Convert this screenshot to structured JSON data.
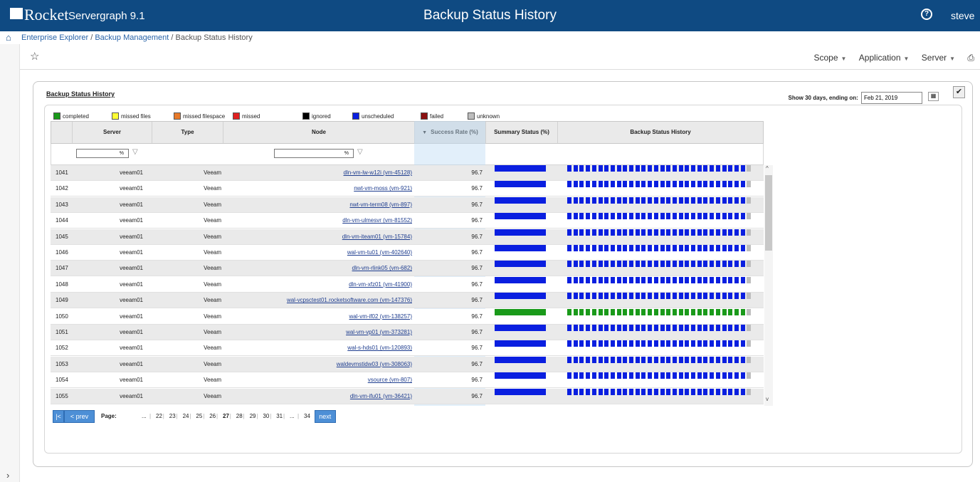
{
  "app": {
    "brand": "Rocket",
    "product": "Servergraph 9.1",
    "page_title": "Backup Status History",
    "user": "steve",
    "help_icon": "?"
  },
  "breadcrumb": {
    "items": [
      "Enterprise Explorer",
      "Backup Management",
      "Backup Status History"
    ],
    "separator": "/"
  },
  "toolbar": {
    "menus": [
      "Scope",
      "Application",
      "Server"
    ]
  },
  "panel": {
    "title": "Backup Status History",
    "show_prefix": "Show 30 days, ending on:",
    "date_value": "Feb 21, 2019"
  },
  "legend": [
    {
      "label": "completed",
      "color": "#1a9a1a"
    },
    {
      "label": "missed files",
      "color": "#ffff33"
    },
    {
      "label": "missed filespace",
      "color": "#e87a2a"
    },
    {
      "label": "missed",
      "color": "#e02020"
    },
    {
      "label": "ignored",
      "color": "#000000"
    },
    {
      "label": "unscheduled",
      "color": "#0a1fe0"
    },
    {
      "label": "failed",
      "color": "#8b1010"
    },
    {
      "label": "unknown",
      "color": "#bdbdbd"
    }
  ],
  "columns": {
    "server": "Server",
    "type": "Type",
    "node": "Node",
    "rate": "Success Rate (%)",
    "summary": "Summary Status (%)",
    "history": "Backup Status History"
  },
  "filters": {
    "server": "%",
    "node": "%"
  },
  "rows": [
    {
      "id": "1041",
      "server": "veeam01",
      "type": "Veeam",
      "node": "dln-vm-lw-w12i (vm-45128)",
      "rate": "96.7",
      "status": "unscheduled"
    },
    {
      "id": "1042",
      "server": "veeam01",
      "type": "Veeam",
      "node": "nwt-vm-moss (vm-921)",
      "rate": "96.7",
      "status": "unscheduled"
    },
    {
      "id": "1043",
      "server": "veeam01",
      "type": "Veeam",
      "node": "nwt-vm-term08 (vm-897)",
      "rate": "96.7",
      "status": "unscheduled"
    },
    {
      "id": "1044",
      "server": "veeam01",
      "type": "Veeam",
      "node": "dln-vm-ulmesvr (vm-81552)",
      "rate": "96.7",
      "status": "unscheduled"
    },
    {
      "id": "1045",
      "server": "veeam01",
      "type": "Veeam",
      "node": "dln-vm-iteam01 (vm-15784)",
      "rate": "96.7",
      "status": "unscheduled"
    },
    {
      "id": "1046",
      "server": "veeam01",
      "type": "Veeam",
      "node": "wal-vm-tu01 (vm-402640)",
      "rate": "96.7",
      "status": "unscheduled"
    },
    {
      "id": "1047",
      "server": "veeam01",
      "type": "Veeam",
      "node": "dln-vm-rlink05 (vm-682)",
      "rate": "96.7",
      "status": "unscheduled"
    },
    {
      "id": "1048",
      "server": "veeam01",
      "type": "Veeam",
      "node": "dln-vm-xfz01 (vm-41900)",
      "rate": "96.7",
      "status": "unscheduled"
    },
    {
      "id": "1049",
      "server": "veeam01",
      "type": "Veeam",
      "node": "wal-vcpsctest01.rocketsoftware.com (vm-147376)",
      "rate": "96.7",
      "status": "unscheduled"
    },
    {
      "id": "1050",
      "server": "veeam01",
      "type": "Veeam",
      "node": "wal-vm-if02 (vm-138257)",
      "rate": "96.7",
      "status": "completed"
    },
    {
      "id": "1051",
      "server": "veeam01",
      "type": "Veeam",
      "node": "wal-vm-vp01 (vm-373281)",
      "rate": "96.7",
      "status": "unscheduled"
    },
    {
      "id": "1052",
      "server": "veeam01",
      "type": "Veeam",
      "node": "wal-s-hds01 (vm-120893)",
      "rate": "96.7",
      "status": "unscheduled"
    },
    {
      "id": "1053",
      "server": "veeam01",
      "type": "Veeam",
      "node": "waldevmstidw03 (vm-308063)",
      "rate": "96.7",
      "status": "unscheduled"
    },
    {
      "id": "1054",
      "server": "veeam01",
      "type": "Veeam",
      "node": "vsource (vm-807)",
      "rate": "96.7",
      "status": "unscheduled"
    },
    {
      "id": "1055",
      "server": "veeam01",
      "type": "Veeam",
      "node": "dln-vm-ifu01 (vm-36421)",
      "rate": "96.7",
      "status": "unscheduled"
    }
  ],
  "pager": {
    "first": "|<",
    "prev": "< prev",
    "label": "Page:",
    "pages": [
      "...",
      "22",
      "23",
      "24",
      "25",
      "26",
      "27",
      "28",
      "29",
      "30",
      "31",
      "...",
      "34"
    ],
    "current": "27",
    "next": "next"
  }
}
